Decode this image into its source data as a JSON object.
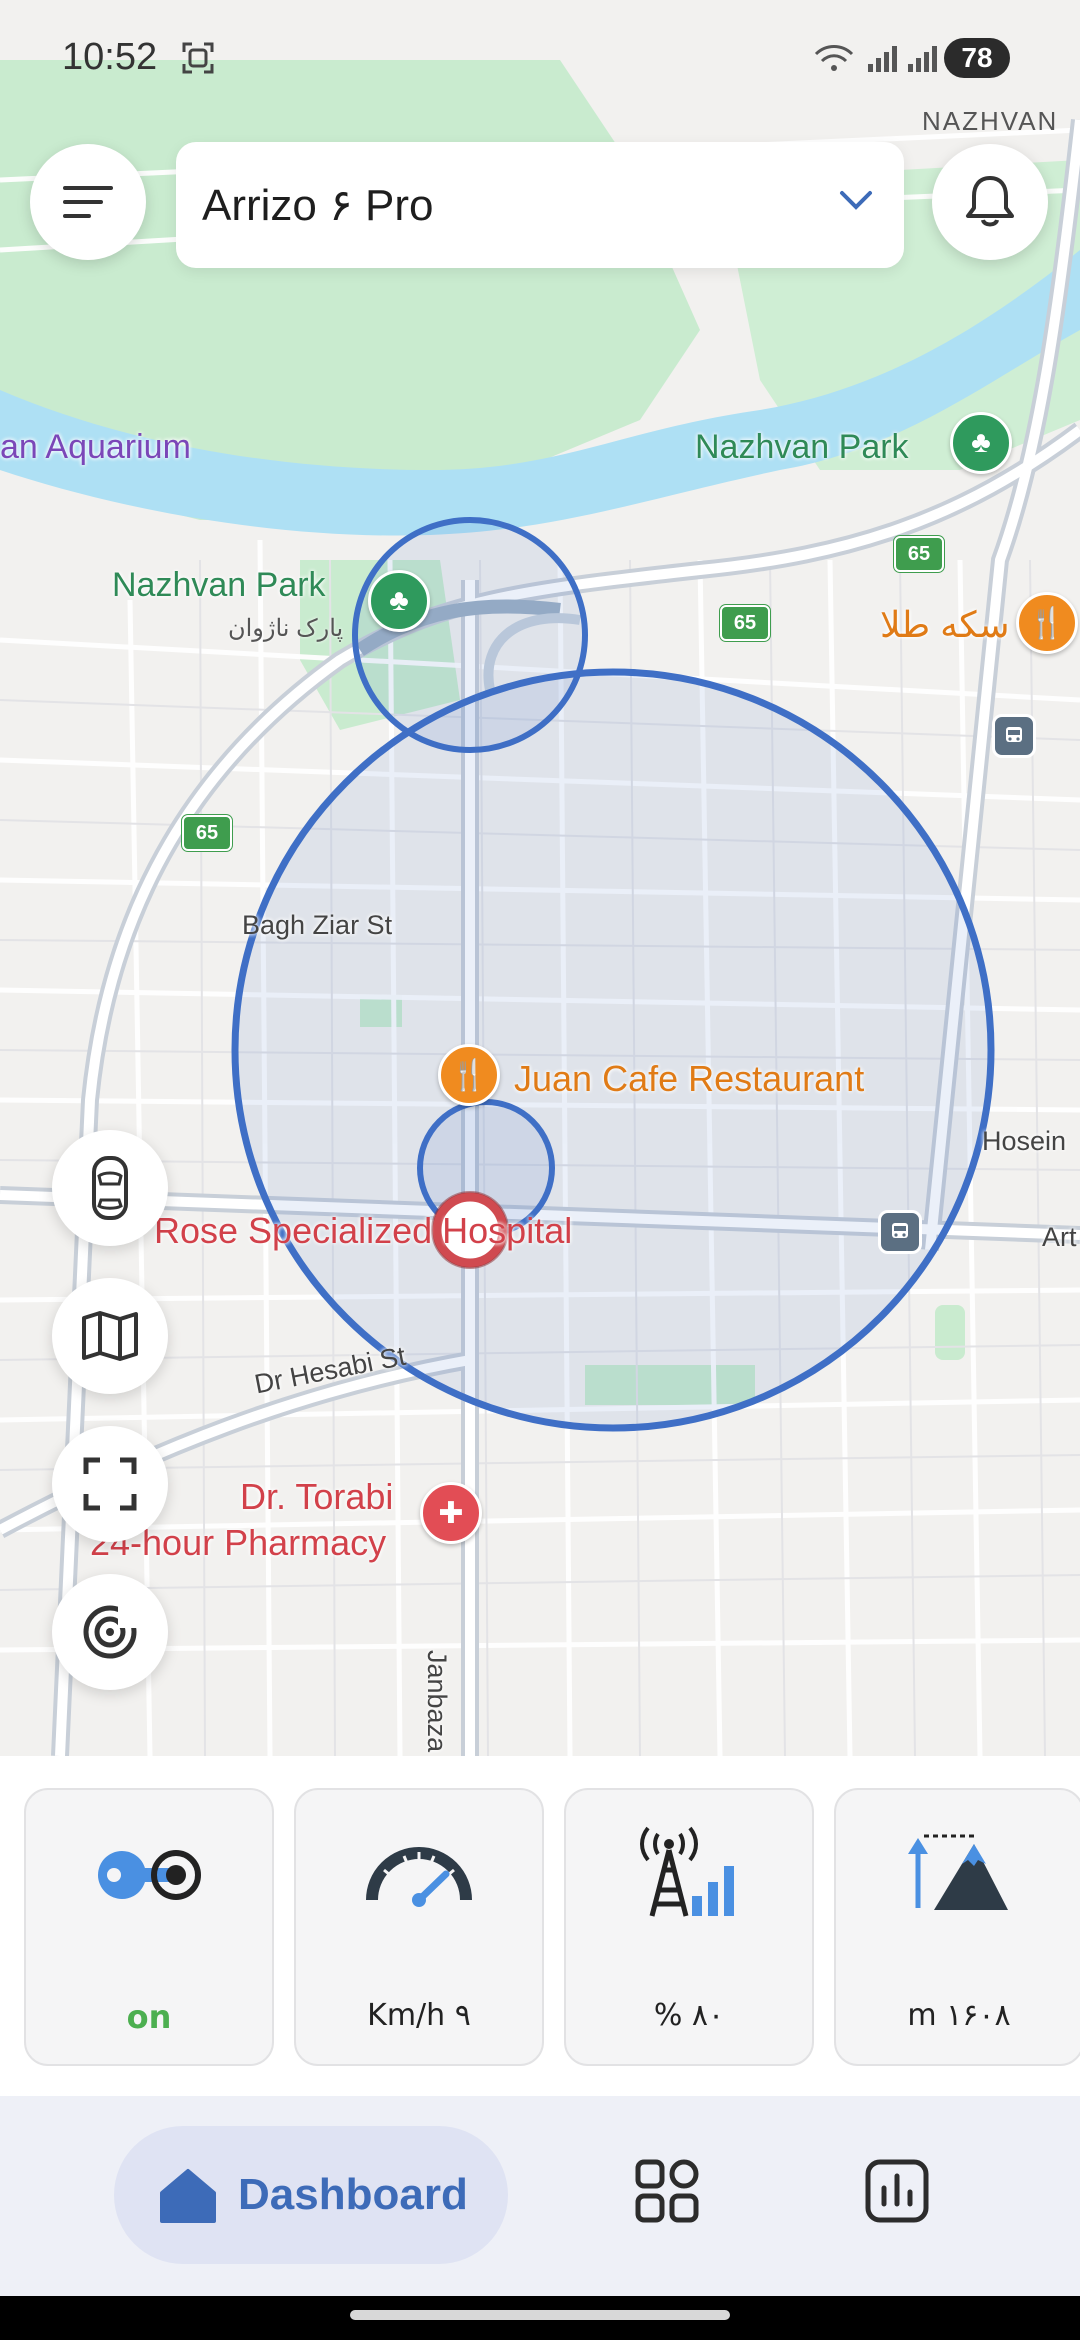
{
  "status_bar": {
    "time": "10:52",
    "battery": "78"
  },
  "header": {
    "vehicle_name": "Arrizo ۶ Pro",
    "menu_icon": "hamburger-menu-icon",
    "notification_icon": "bell-icon"
  },
  "map": {
    "labels": {
      "region": "NAZHVAN",
      "aquarium": "an Aquarium",
      "park_right": "Nazhvan Park",
      "park_left": "Nazhvan Park",
      "park_left_fa": "پارک ناژوان",
      "sekke": "سکه طلا",
      "bagh_ziar": "Bagh Ziar St",
      "juan_cafe": "Juan Cafe Restaurant",
      "hosein": "Hosein",
      "rose_hospital": "Rose Specialized Hospital",
      "art": "Art",
      "dr_hesabi": "Dr Hesabi St",
      "pharmacy_line1": "Dr. Torabi",
      "pharmacy_line2": "24-hour Pharmacy",
      "janbaz": "Janbaza"
    },
    "road_shields": [
      "65",
      "65",
      "65"
    ],
    "colors": {
      "geofence": "#3f6fc6",
      "water": "#aee0f4",
      "park": "#c9ebcf",
      "road": "#ffffff"
    }
  },
  "side_buttons": [
    {
      "name": "car-view-button",
      "icon": "car-top-view-icon"
    },
    {
      "name": "map-layers-button",
      "icon": "map-icon"
    },
    {
      "name": "fullscreen-button",
      "icon": "fullscreen-icon"
    },
    {
      "name": "recenter-button",
      "icon": "target-icon"
    }
  ],
  "stats": {
    "ignition": {
      "icon": "key-icon",
      "value": "on"
    },
    "speed": {
      "icon": "speedometer-icon",
      "value": "Km/h ۹"
    },
    "signal": {
      "icon": "signal-tower-icon",
      "value": "% ۸۰"
    },
    "altitude": {
      "icon": "mountain-altitude-icon",
      "value": "m ۱۶۰۸"
    }
  },
  "bottom_nav": {
    "dashboard_label": "Dashboard",
    "dashboard_icon": "home-icon",
    "apps_icon": "apps-grid-icon",
    "reports_icon": "chart-icon"
  }
}
